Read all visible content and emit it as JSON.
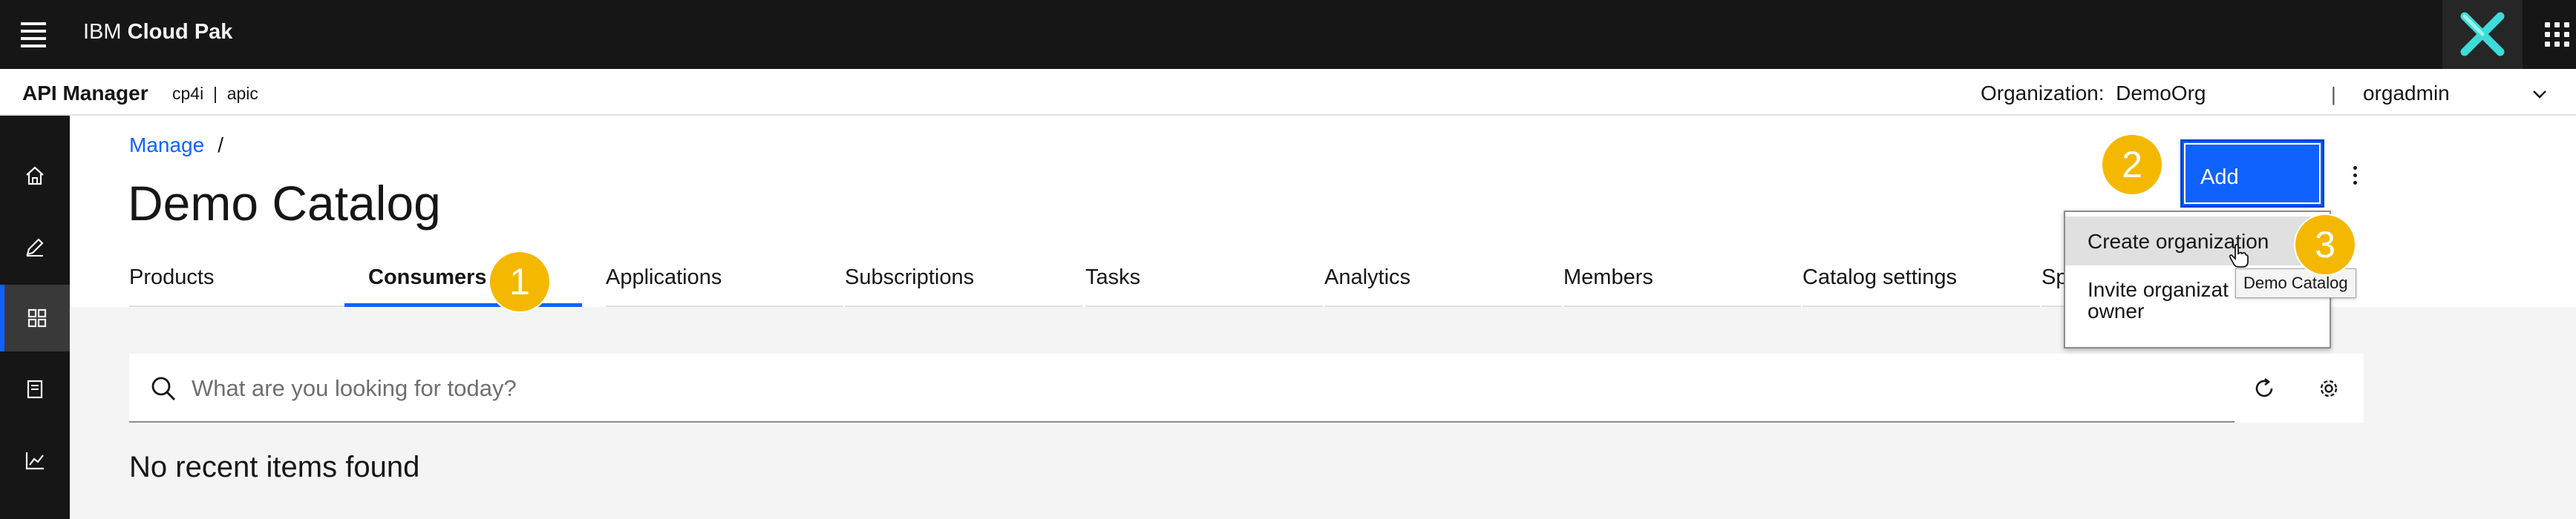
{
  "topbar": {
    "brand_prefix": "IBM ",
    "brand_name": "Cloud Pak"
  },
  "subbar": {
    "app_name": "API Manager",
    "context": "cp4i  |  apic",
    "org_label": "Organization:  DemoOrg",
    "divider": "|",
    "user": "orgadmin"
  },
  "sidebar": {
    "items": [
      {
        "icon": "home-icon"
      },
      {
        "icon": "edit-icon"
      },
      {
        "icon": "grid-icon",
        "active": true
      },
      {
        "icon": "document-icon"
      },
      {
        "icon": "analytics-icon"
      }
    ]
  },
  "breadcrumb": {
    "link": "Manage",
    "separator": "/"
  },
  "page": {
    "title": "Demo Catalog"
  },
  "tabs": [
    {
      "label": "Products"
    },
    {
      "label": "Consumers",
      "active": true
    },
    {
      "label": "Applications"
    },
    {
      "label": "Subscriptions"
    },
    {
      "label": "Tasks"
    },
    {
      "label": "Analytics"
    },
    {
      "label": "Members"
    },
    {
      "label": "Catalog settings"
    },
    {
      "label": "Sp"
    }
  ],
  "toolbar": {
    "add_label": "Add"
  },
  "dropdown": {
    "item_1": "Create organization",
    "item_2": "Invite organizat\nowner"
  },
  "tooltip": {
    "text": "Demo Catalog"
  },
  "search": {
    "placeholder": "What are you looking for today?"
  },
  "empty_state": {
    "text": "No recent items found"
  },
  "badges": {
    "b1": "1",
    "b2": "2",
    "b3": "3"
  },
  "colors": {
    "accent": "#0f62fe",
    "badge": "#f5b800",
    "topbar": "#161616",
    "body_bg": "#f4f4f4"
  }
}
